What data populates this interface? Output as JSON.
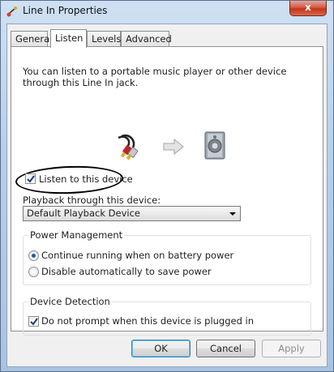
{
  "window": {
    "title": "Line In Properties",
    "close_glyph": "x"
  },
  "tabs": [
    {
      "label": "General"
    },
    {
      "label": "Listen"
    },
    {
      "label": "Levels"
    },
    {
      "label": "Advanced"
    }
  ],
  "listen": {
    "description": "You can listen to a portable music player or other device through this Line In jack.",
    "listen_checkbox": {
      "label": "Listen to this device",
      "checked": true
    },
    "playback_label": "Playback through this device:",
    "playback_select": {
      "value": "Default Playback Device"
    },
    "power_group": {
      "title": "Power Management",
      "options": [
        {
          "label": "Continue running when on battery power",
          "selected": true
        },
        {
          "label": "Disable automatically to save power",
          "selected": false
        }
      ]
    },
    "detection_group": {
      "title": "Device Detection",
      "checkbox": {
        "label": "Do not prompt when this device is plugged in",
        "checked": true
      }
    }
  },
  "buttons": {
    "ok": "OK",
    "cancel": "Cancel",
    "apply": "Apply"
  },
  "icons": [
    "app-icon",
    "rca-cable-icon",
    "arrow-right-icon",
    "speaker-icon",
    "check-icon"
  ],
  "colors": {
    "accent": "#1d5ab0",
    "close": "#c1341a",
    "annotation": "#000000"
  }
}
